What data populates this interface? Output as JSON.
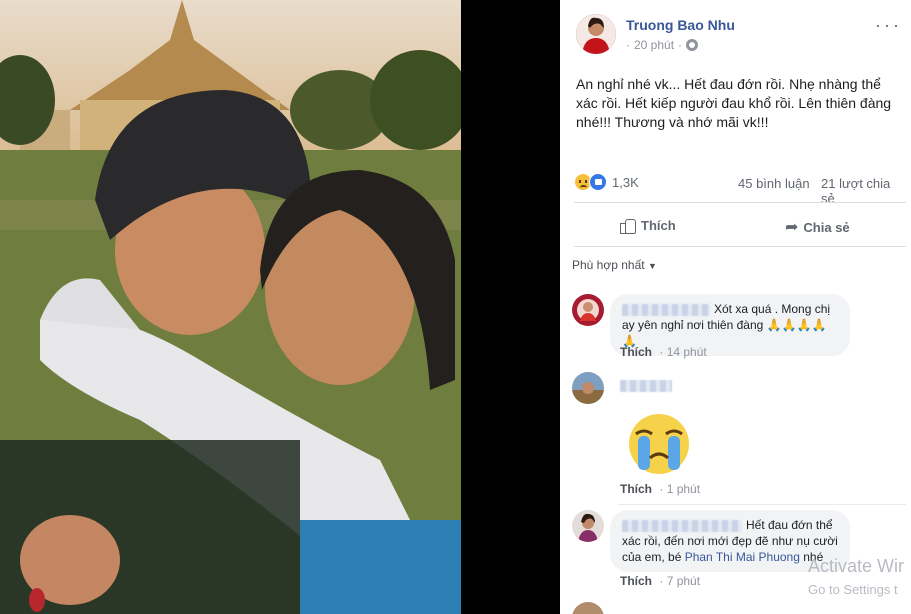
{
  "post": {
    "author": "Truong Bao Nhu",
    "time": "20 phút",
    "text": "An nghỉ nhé vk... Hết đau đớn rồi. Nhẹ nhàng thể xác rồi. Hết kiếp người đau khổ rồi. Lên thiên đàng nhé!!! Thương và nhớ mãi vk!!!",
    "reaction_count": "1,3K",
    "comment_count": "45 bình luận",
    "share_count": "21 lượt chia sẻ",
    "reaction_icons": [
      "sad-reaction-icon",
      "like-reaction-icon"
    ]
  },
  "actions": {
    "like": "Thích",
    "share": "Chia sẻ"
  },
  "sort_label": "Phù hợp nhất",
  "comments": [
    {
      "text": "Xót xa quá . Mong chị ay yên nghỉ nơi thiên đàng 🙏🙏🙏🙏🙏",
      "like": "Thích",
      "time": "14 phút"
    },
    {
      "text": "",
      "sticker": "crying-face-sticker",
      "like": "Thích",
      "time": "1 phút"
    },
    {
      "text_before": "Hết đau đớn thể xác rồi, đến nơi mới đẹp đẽ như nụ cười của em, bé ",
      "mention": "Phan Thi Mai Phuong",
      "text_after": " nhé",
      "like": "Thích",
      "time": "7 phút"
    }
  ],
  "watermark": {
    "line1": "Activate Wir",
    "line2": "Go to Settings t"
  },
  "colors": {
    "link": "#385898",
    "bubble": "#f2f3f5",
    "muted": "#606770"
  }
}
